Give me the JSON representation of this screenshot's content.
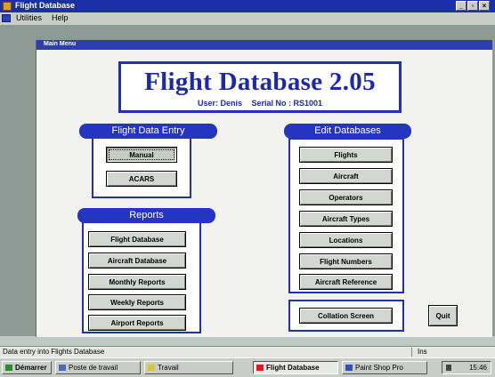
{
  "window": {
    "title": "Flight Database",
    "buttons": [
      "_",
      "▫",
      "×"
    ]
  },
  "menubar": {
    "items": [
      "Utilities",
      "Help"
    ]
  },
  "inner_window": {
    "title": "Main Menu"
  },
  "header": {
    "title": "Flight Database 2.05",
    "user_label": "User: Denis",
    "serial_label": "Serial No : RS1001"
  },
  "flight_data_entry": {
    "label": "Flight Data Entry",
    "buttons": [
      "Manual",
      "ACARS"
    ]
  },
  "reports": {
    "label": "Reports",
    "buttons": [
      "Flight Database",
      "Aircraft Database",
      "Monthly Reports",
      "Weekly Reports",
      "Airport Reports"
    ]
  },
  "edit_databases": {
    "label": "Edit Databases",
    "buttons": [
      "Flights",
      "Aircraft",
      "Operators",
      "Aircraft Types",
      "Locations",
      "Flight Numbers",
      "Aircraft Reference"
    ]
  },
  "collation": {
    "label": "Collation Screen"
  },
  "quit": {
    "label": "Quit"
  },
  "statusbar": {
    "message": "Data entry into Flights Database",
    "mode": "Ins"
  },
  "taskbar": {
    "start": "Démarrer",
    "items": [
      "Poste de travail",
      "Travail",
      "Flight Database",
      "Paint Shop Pro"
    ],
    "clock": "15:46"
  },
  "colors": {
    "accent": "#1f2fb8",
    "pill": "#2535c0",
    "titlebar": "#1a2fa8"
  }
}
